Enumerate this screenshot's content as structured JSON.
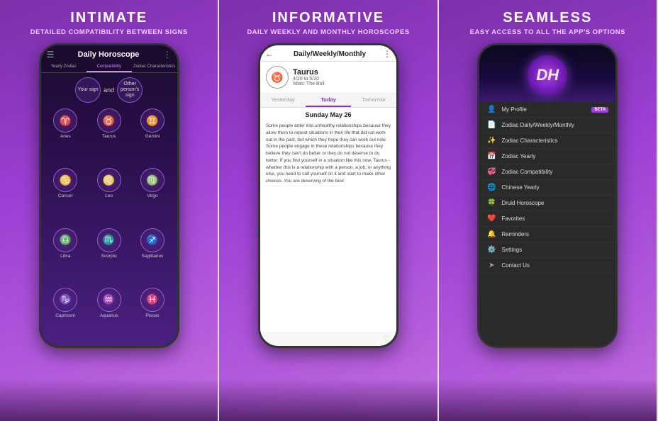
{
  "panel1": {
    "title": "INTIMATE",
    "subtitle": "DETAILED COMPATIBILITY BETWEEN SIGNS",
    "app_title": "Daily Horoscope",
    "tabs": [
      "Yearly Zodiac",
      "Compatibility",
      "Zodiac Characteristics"
    ],
    "your_sign": "Your sign",
    "other_sign": "Other person's sign",
    "and_text": "and",
    "signs": [
      {
        "name": "Aries",
        "symbol": "♈"
      },
      {
        "name": "Taurus",
        "symbol": "♉"
      },
      {
        "name": "Gemini",
        "symbol": "♊"
      },
      {
        "name": "Cancer",
        "symbol": "♋"
      },
      {
        "name": "Leo",
        "symbol": "♌"
      },
      {
        "name": "Virgo",
        "symbol": "♍"
      },
      {
        "name": "Libra",
        "symbol": "♎"
      },
      {
        "name": "Scorpio",
        "symbol": "♏"
      },
      {
        "name": "Sagittarius",
        "symbol": "♐"
      },
      {
        "name": "Capricorn",
        "symbol": "♑"
      },
      {
        "name": "Aquarius",
        "symbol": "♒"
      },
      {
        "name": "Pisces",
        "symbol": "♓"
      }
    ]
  },
  "panel2": {
    "title": "INFORMATIVE",
    "subtitle": "DAILY WEEKLY AND MONTHLY HOROSCOPES",
    "screen_title": "Daily/Weekly/Monthly",
    "sign_name": "Taurus",
    "sign_dates": "4/20 to 5/20",
    "sign_alias": "Alias: The Bull",
    "sign_symbol": "♉",
    "day_tabs": [
      "Yesterday",
      "Today",
      "Tomorrow"
    ],
    "date_heading": "Sunday May 26",
    "horoscope_text": "Some people enter into unhealthy relationships because they allow them to repeat situations in their life that did not work out in the past, but which they hope they can work out now. Some people engage in these relationships because they believe they can't do better or they do not deserve to do better. If you find yourself in a situation like this now, Taurus - whether this is a relationship with a person, a job, or anything else, you need to call yourself on it and start to make other choices. You are deserving of the best."
  },
  "panel3": {
    "title": "SEAMLESS",
    "subtitle": "EASY ACCESS TO ALL THE APP'S OPTIONS",
    "logo_text": "DH",
    "menu_items": [
      {
        "label": "My Profile",
        "icon": "👤",
        "badge": "BETA"
      },
      {
        "label": "Zodiac Daily/Weekly/Monthly",
        "icon": "📄",
        "badge": null
      },
      {
        "label": "Zodiac Characteristics",
        "icon": "✨",
        "badge": null
      },
      {
        "label": "Zodiac Yearly",
        "icon": "📅",
        "badge": null
      },
      {
        "label": "Zodiac Compatibility",
        "icon": "💞",
        "badge": null
      },
      {
        "label": "Chinese Yearly",
        "icon": "🌐",
        "badge": null
      },
      {
        "label": "Druid Horoscope",
        "icon": "🍀",
        "badge": null
      },
      {
        "label": "Favorites",
        "icon": "❤️",
        "badge": null
      },
      {
        "label": "Reminders",
        "icon": "🔔",
        "badge": null
      },
      {
        "label": "Settings",
        "icon": "⚙️",
        "badge": null
      },
      {
        "label": "Contact Us",
        "icon": "➤",
        "badge": null
      }
    ]
  }
}
